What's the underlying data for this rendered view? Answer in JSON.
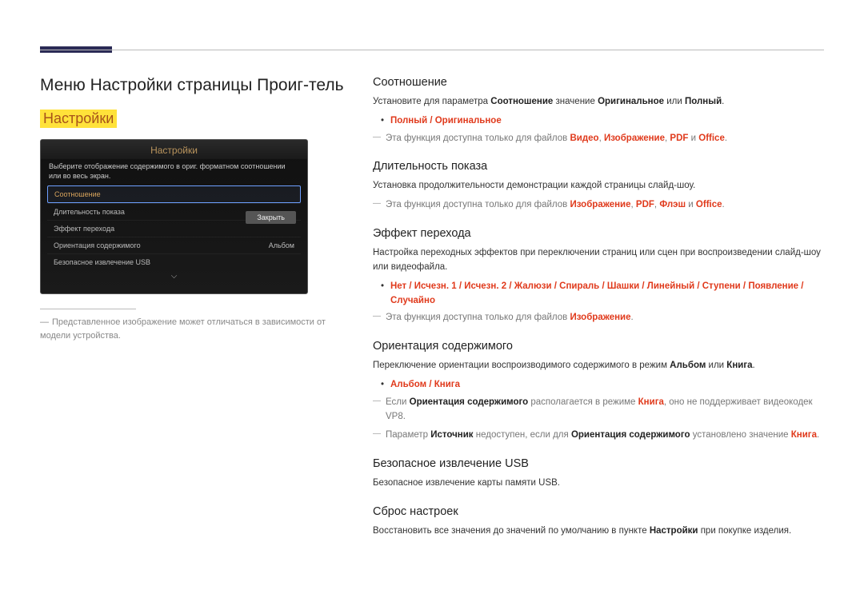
{
  "header": {
    "title": "Меню Настройки страницы Проиг-тель",
    "highlight": "Настройки"
  },
  "shot": {
    "title": "Настройки",
    "desc": "Выберите отображение содержимого в ориг. форматном соотношении или во весь экран.",
    "items": {
      "i0": "Соотношение",
      "i1": "Длительность показа",
      "i2": "Эффект перехода",
      "i3": "Ориентация содержимого",
      "i3_val": "Альбом",
      "i4": "Безопасное извлечение USB"
    },
    "close": "Закрыть",
    "arrow": "⌵"
  },
  "caption": "Представленное изображение может отличаться в зависимости от модели устройства.",
  "s1": {
    "h": "Соотношение",
    "p1_a": "Установите для параметра ",
    "p1_b": "Соотношение",
    "p1_c": " значение ",
    "p1_d": "Оригинальное",
    "p1_e": " или ",
    "p1_f": "Полный",
    "p1_g": ".",
    "opts": "Полный / Оригинальное",
    "note_a": "Эта функция доступна только для файлов ",
    "note_v": "Видео",
    "note_sep": ", ",
    "note_img": "Изображение",
    "note_pdf": "PDF",
    "note_and": " и ",
    "note_off": "Office",
    "note_end": "."
  },
  "s2": {
    "h": "Длительность показа",
    "p": "Установка продолжительности демонстрации каждой страницы слайд-шоу.",
    "note_a": "Эта функция доступна только для файлов ",
    "note_img": "Изображение",
    "note_sep": ", ",
    "note_pdf": "PDF",
    "note_fl": "Флэш",
    "note_and": " и ",
    "note_off": "Office",
    "note_end": "."
  },
  "s3": {
    "h": "Эффект перехода",
    "p": "Настройка переходных эффектов при переключении страниц или сцен при воспроизведении слайд-шоу или видеофайла.",
    "opts": "Нет / Исчезн. 1 / Исчезн. 2 / Жалюзи / Спираль / Шашки / Линейный / Ступени / Появление / Случайно",
    "note_a": "Эта функция доступна только для файлов ",
    "note_img": "Изображение",
    "note_end": "."
  },
  "s4": {
    "h": "Ориентация содержимого",
    "p_a": "Переключение ориентации воспроизводимого содержимого в режим ",
    "p_al": "Альбом",
    "p_or": " или ",
    "p_bk": "Книга",
    "p_end": ".",
    "opts": "Альбом / Книга",
    "n1_a": "Если ",
    "n1_b": "Ориентация содержимого",
    "n1_c": " располагается в режиме ",
    "n1_d": "Книга",
    "n1_e": ", оно не поддерживает видеокодек VP8.",
    "n2_a": "Параметр ",
    "n2_b": "Источник",
    "n2_c": " недоступен, если для ",
    "n2_d": "Ориентация содержимого",
    "n2_e": " установлено значение ",
    "n2_f": "Книга",
    "n2_g": "."
  },
  "s5": {
    "h": "Безопасное извлечение USB",
    "p": "Безопасное извлечение карты памяти USB."
  },
  "s6": {
    "h": "Сброс настроек",
    "p_a": "Восстановить все значения до значений по умолчанию в пункте ",
    "p_b": "Настройки",
    "p_c": " при покупке изделия."
  }
}
